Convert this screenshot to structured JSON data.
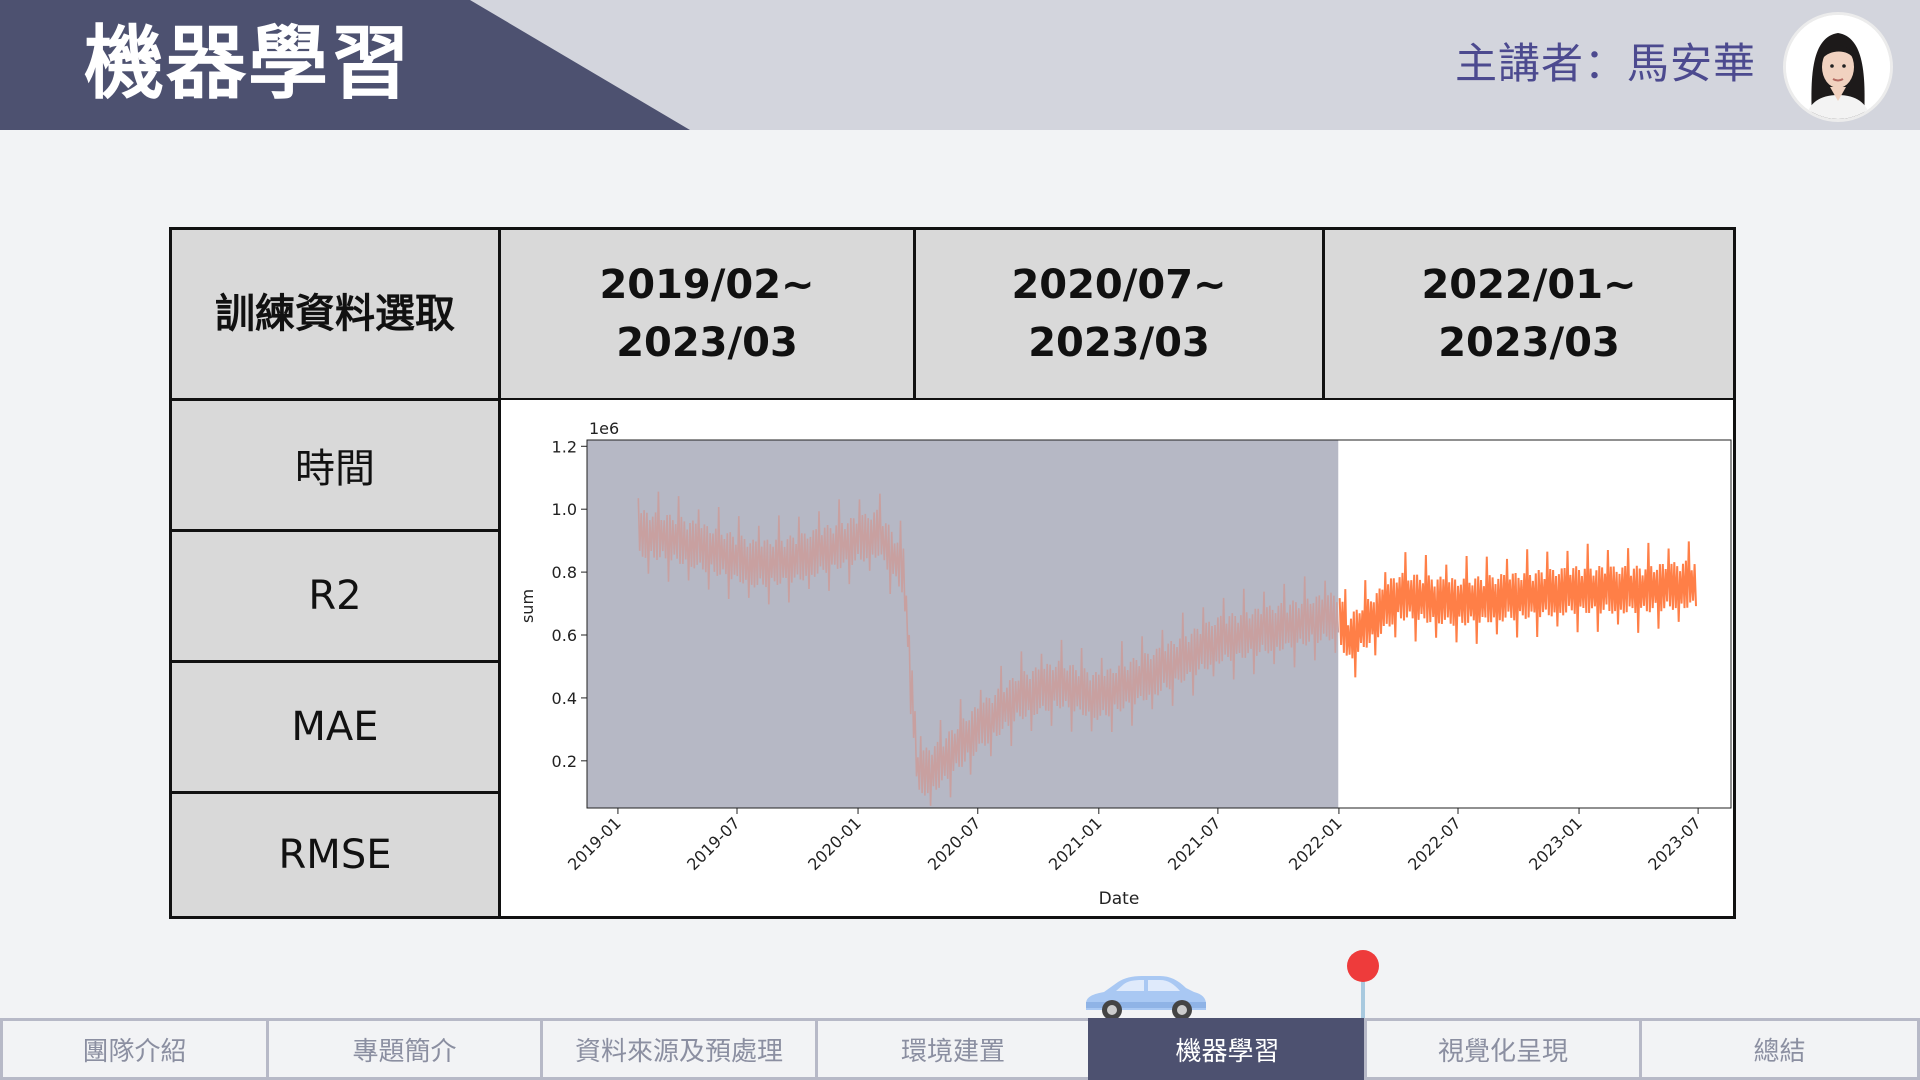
{
  "header": {
    "title": "機器學習",
    "presenter": "主講者：馬安華"
  },
  "table": {
    "corner_label": "訓練資料選取",
    "columns": [
      {
        "line1": "2019/02~",
        "line2": "2023/03"
      },
      {
        "line1": "2020/07~",
        "line2": "2023/03"
      },
      {
        "line1": "2022/01~",
        "line2": "2023/03"
      }
    ],
    "row_labels": [
      "時間",
      "R2",
      "MAE",
      "RMSE"
    ]
  },
  "chart_data": {
    "type": "line",
    "xlabel": "Date",
    "ylabel": "sum",
    "y_multiplier_label": "1e6",
    "x_ticks": [
      "2019-01",
      "2019-07",
      "2020-01",
      "2020-07",
      "2021-01",
      "2021-07",
      "2022-01",
      "2022-07",
      "2023-01",
      "2023-07"
    ],
    "y_ticks": [
      "0.2",
      "0.4",
      "0.6",
      "0.8",
      "1.0",
      "1.2"
    ],
    "ylim": [
      0.05,
      1.22
    ],
    "xlim": [
      "2018-11-15",
      "2023-08-20"
    ],
    "shaded_region": {
      "from": "2018-11-15",
      "to": "2021-12-31",
      "color": "#b6b8c5"
    },
    "series": [
      {
        "color_faded": "#c8a0a0",
        "color": "#ff7f47",
        "highlight_from": "2022-01-01",
        "points": [
          {
            "date": "2019-02-01",
            "y": 0.92
          },
          {
            "date": "2019-04-01",
            "y": 0.9
          },
          {
            "date": "2019-06-01",
            "y": 0.86
          },
          {
            "date": "2019-08-01",
            "y": 0.82
          },
          {
            "date": "2019-10-01",
            "y": 0.84
          },
          {
            "date": "2019-12-01",
            "y": 0.88
          },
          {
            "date": "2020-02-01",
            "y": 0.92
          },
          {
            "date": "2020-03-10",
            "y": 0.8
          },
          {
            "date": "2020-04-01",
            "y": 0.15
          },
          {
            "date": "2020-05-01",
            "y": 0.18
          },
          {
            "date": "2020-07-01",
            "y": 0.3
          },
          {
            "date": "2020-09-01",
            "y": 0.4
          },
          {
            "date": "2020-11-01",
            "y": 0.44
          },
          {
            "date": "2021-01-01",
            "y": 0.4
          },
          {
            "date": "2021-04-01",
            "y": 0.48
          },
          {
            "date": "2021-07-01",
            "y": 0.58
          },
          {
            "date": "2021-10-01",
            "y": 0.62
          },
          {
            "date": "2021-12-31",
            "y": 0.66
          },
          {
            "date": "2022-01-15",
            "y": 0.58
          },
          {
            "date": "2022-04-01",
            "y": 0.72
          },
          {
            "date": "2022-07-01",
            "y": 0.7
          },
          {
            "date": "2022-10-01",
            "y": 0.72
          },
          {
            "date": "2023-01-01",
            "y": 0.74
          },
          {
            "date": "2023-04-01",
            "y": 0.74
          },
          {
            "date": "2023-06-30",
            "y": 0.76
          }
        ]
      }
    ]
  },
  "nav": {
    "tabs": [
      "團隊介紹",
      "專題簡介",
      "資料來源及預處理",
      "環境建置",
      "機器學習",
      "視覺化呈現",
      "總結"
    ],
    "active_index": 4
  },
  "colors": {
    "header_bg": "#d3d5dd",
    "accent": "#4d5170",
    "presenter_text": "#4c4a8f",
    "pin": "#ee3b3b"
  }
}
